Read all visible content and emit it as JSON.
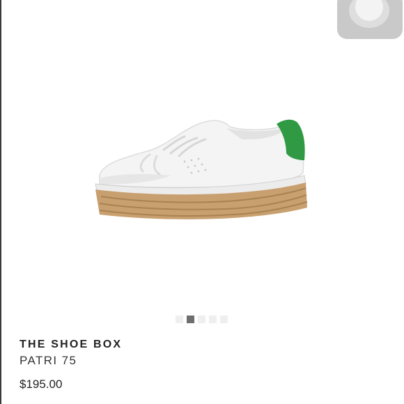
{
  "product": {
    "brand": "THE SHOE BOX",
    "name": "PATRI 75",
    "price": "$195.00",
    "image_icon": "sneaker-espadrille-image"
  },
  "gallery": {
    "total_images": 5,
    "active_index": 1
  },
  "assistive_touch": {
    "icon": "assistive-touch-icon"
  },
  "colors": {
    "background": "#ffffff",
    "text": "#222222",
    "active_dot": "#6e6e6e",
    "inactive_dot": "#efefef",
    "heel_tab": "#2f9a43",
    "sole": "#c8a070"
  }
}
